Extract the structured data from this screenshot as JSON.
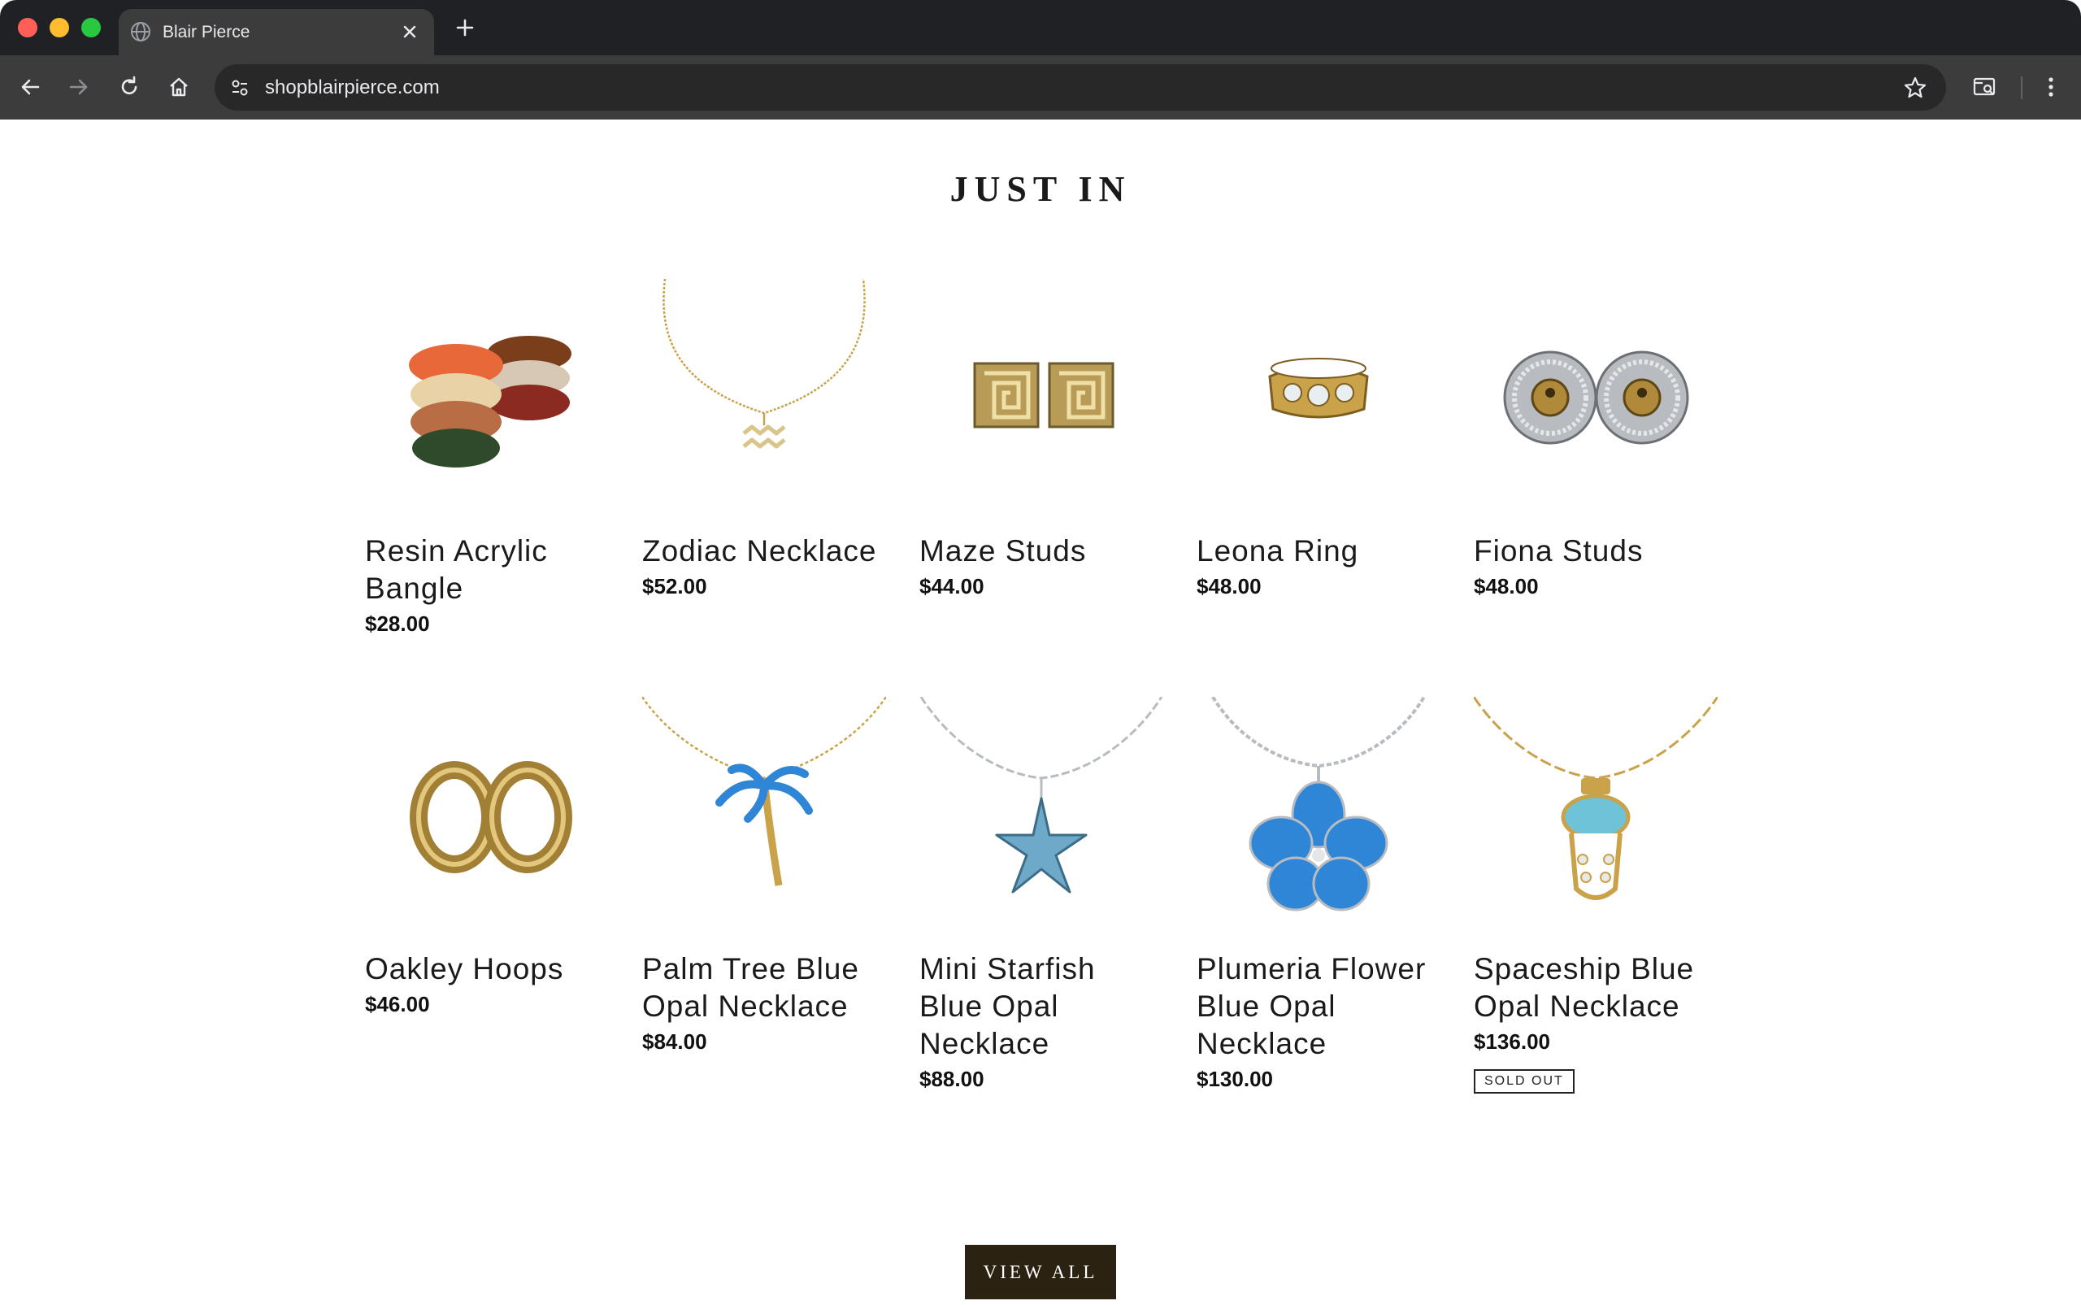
{
  "browser": {
    "tab_title": "Blair Pierce",
    "url": "shopblairpierce.com"
  },
  "section": {
    "title": "JUST IN"
  },
  "products": [
    {
      "title": "Resin Acrylic Bangle",
      "price": "$28.00"
    },
    {
      "title": "Zodiac Necklace",
      "price": "$52.00"
    },
    {
      "title": "Maze Studs",
      "price": "$44.00"
    },
    {
      "title": "Leona Ring",
      "price": "$48.00"
    },
    {
      "title": "Fiona Studs",
      "price": "$48.00"
    },
    {
      "title": "Oakley Hoops",
      "price": "$46.00"
    },
    {
      "title": "Palm Tree Blue Opal Necklace",
      "price": "$84.00"
    },
    {
      "title": "Mini Starfish Blue Opal Necklace",
      "price": "$88.00"
    },
    {
      "title": "Plumeria Flower Blue Opal Necklace",
      "price": "$130.00"
    },
    {
      "title": "Spaceship Blue Opal Necklace",
      "price": "$136.00",
      "badge": "SOLD OUT"
    }
  ],
  "view_all_label": "VIEW ALL",
  "colors": {
    "button_bg": "#2b2211",
    "gold": "#c9a24a",
    "opal_blue": "#2f86d6",
    "silver": "#b8bcc0"
  }
}
